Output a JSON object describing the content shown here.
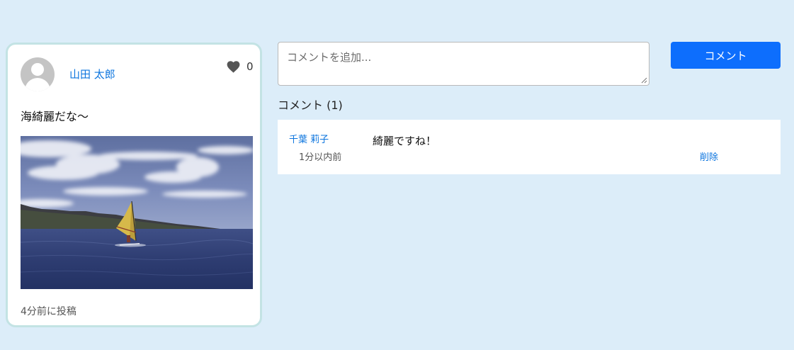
{
  "post": {
    "author": "山田 太郎",
    "likes": "0",
    "text": "海綺麗だな〜",
    "posted_time": "4分前に投稿"
  },
  "comment_form": {
    "placeholder": "コメントを追加...",
    "button_label": "コメント"
  },
  "comments": {
    "heading": "コメント",
    "count": "1",
    "items": [
      {
        "author": "千葉 莉子",
        "time": "1分以内前",
        "text": "綺麗ですね！",
        "delete_label": "削除"
      }
    ]
  },
  "colors": {
    "background": "#dcedf9",
    "card_border": "#c3e3e4",
    "link": "#0b74de",
    "primary_button": "#0d6efd"
  },
  "icons": {
    "avatar": "user-avatar-placeholder",
    "like": "heart-icon"
  }
}
